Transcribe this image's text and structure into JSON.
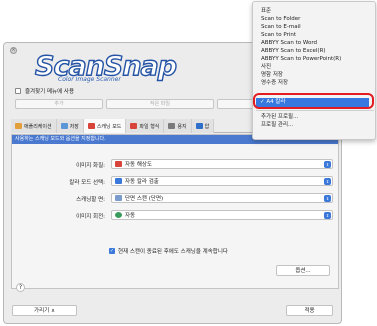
{
  "logo": {
    "title": "ScanSnap",
    "subtitle": "Color Image Scanner"
  },
  "favorites_label": "즐겨찾기 메뉴에 사용",
  "top_buttons": [
    "추가",
    "작은 파일",
    "고화질"
  ],
  "tabs": [
    {
      "label": "애플리케이션",
      "icon": "app-icon",
      "color": "#e2a03b"
    },
    {
      "label": "저장",
      "icon": "folder-icon",
      "color": "#5a97d8"
    },
    {
      "label": "스캐닝 모드",
      "icon": "scan-mode-icon",
      "color": "#d9443a"
    },
    {
      "label": "파일 형식",
      "icon": "file-format-icon",
      "color": "#d9443a"
    },
    {
      "label": "용지",
      "icon": "paper-icon",
      "color": "#7a7a7a"
    },
    {
      "label": "압",
      "icon": "compress-icon",
      "color": "#2f6ec9"
    }
  ],
  "info_bar": "사용하는 스캐닝 모드와 옵션을 지정합니다.",
  "settings": [
    {
      "label": "이미지 화질:",
      "value": "자동 해상도",
      "icon_color": "#d9443a"
    },
    {
      "label": "칼라 모드 선택:",
      "value": "자동 칼라 검출",
      "icon_color": "#3a78d9"
    },
    {
      "label": "스캐닝할 면:",
      "value": "단면 스캔 (단면)",
      "icon_color": "#7a9ccc"
    },
    {
      "label": "이미지 회전:",
      "value": "자동",
      "icon_color": "#3a9b5c"
    }
  ],
  "continue_scan_label": "현재 스캔이 종료된 후에도 스캐닝을 계속합니다",
  "options_button": "옵션...",
  "help_button": "?",
  "hide_button": "가리기 ∧",
  "apply_button": "적용",
  "context_menu": {
    "items": [
      "표준",
      "Scan to Folder",
      "Scan to E-mail",
      "Scan to Print",
      "ABBYY Scan to Word",
      "ABBYY Scan to Excel(R)",
      "ABBYY Scan to PowerPoint(R)",
      "사진",
      "명함 저장",
      "영수증 저장"
    ],
    "selected": "✓ A4 칼라",
    "footer_items": [
      "추가된 프로필...",
      "프로필 관리..."
    ]
  },
  "colors": {
    "accent": "#3a78d9",
    "highlight_ring": "#e31b23",
    "info_bar": "#4a79cf"
  }
}
